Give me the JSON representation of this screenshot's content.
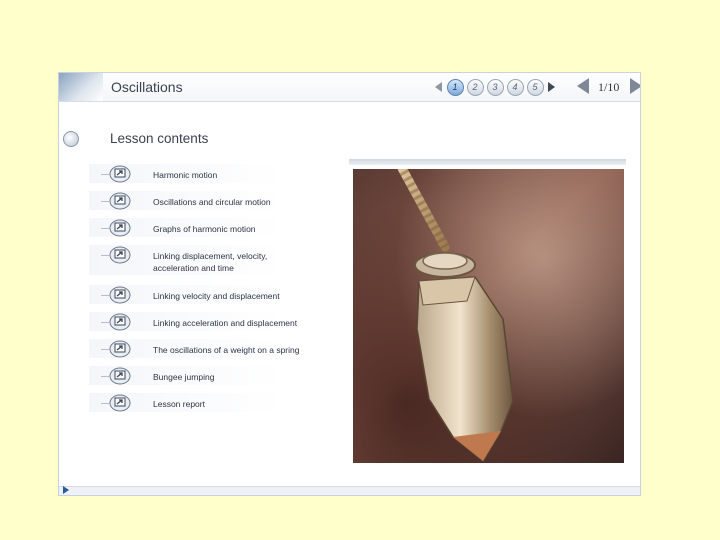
{
  "header": {
    "title": "Oscillations",
    "pages": [
      "1",
      "2",
      "3",
      "4",
      "5"
    ],
    "active_page": "1",
    "page_count": "1/10"
  },
  "contents": {
    "title": "Lesson contents",
    "items": [
      {
        "label": "Harmonic motion"
      },
      {
        "label": "Oscillations and circular motion"
      },
      {
        "label": "Graphs of harmonic motion"
      },
      {
        "label": "Linking displacement, velocity,",
        "label2": "acceleration and time"
      },
      {
        "label": "Linking velocity and displacement"
      },
      {
        "label": "Linking acceleration and displacement"
      },
      {
        "label": "The oscillations of a weight on a spring"
      },
      {
        "label": "Bungee jumping"
      },
      {
        "label": "Lesson report"
      }
    ]
  },
  "icons": {
    "item_icon": "lesson-link-icon",
    "prev_page": "arrow-left-icon",
    "next_page": "arrow-right-icon"
  },
  "colors": {
    "background": "#ffffcc",
    "accent": "#2b5a9a"
  }
}
